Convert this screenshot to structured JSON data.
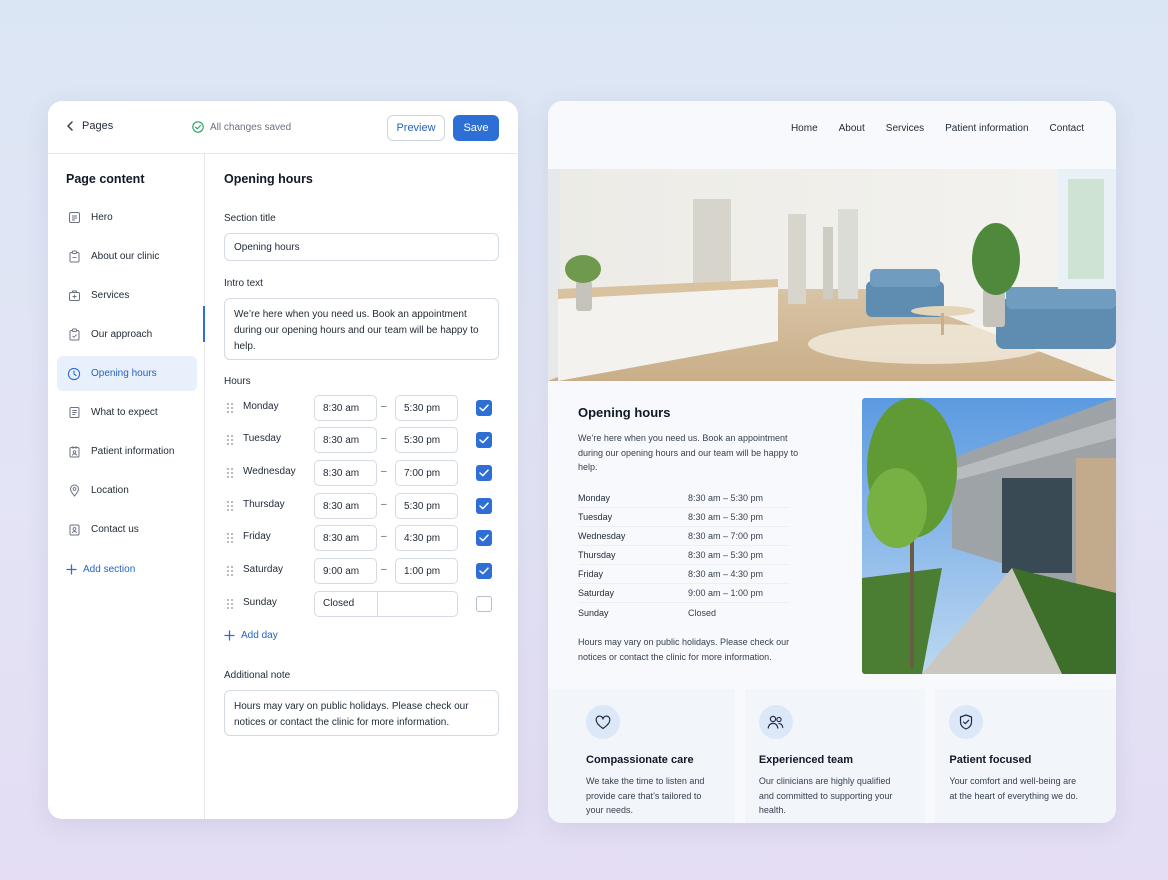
{
  "editor": {
    "back_label": "Pages",
    "save_status": "All changes saved",
    "preview_button": "Preview",
    "save_button": "Save",
    "sidebar": {
      "title": "Page content",
      "items": [
        {
          "label": "Hero",
          "icon": "text-block-icon"
        },
        {
          "label": "About our clinic",
          "icon": "clipboard-icon"
        },
        {
          "label": "Services",
          "icon": "medical-case-icon"
        },
        {
          "label": "Our approach",
          "icon": "clipboard-check-icon"
        },
        {
          "label": "Opening hours",
          "icon": "clock-icon",
          "active": true
        },
        {
          "label": "What to expect",
          "icon": "document-icon"
        },
        {
          "label": "Patient information",
          "icon": "id-badge-icon"
        },
        {
          "label": "Location",
          "icon": "map-pin-icon"
        },
        {
          "label": "Contact us",
          "icon": "contact-card-icon"
        }
      ],
      "add_section": "Add section"
    },
    "form": {
      "title": "Opening hours",
      "section_title_label": "Section title",
      "section_title_value": "Opening hours",
      "intro_label": "Intro text",
      "intro_value": "We’re here when you need us. Book an appointment during our opening hours and our team will be happy to help.",
      "hours_label": "Hours",
      "hours": [
        {
          "day": "Monday",
          "from": "8:30 am",
          "to": "5:30 pm",
          "open": true
        },
        {
          "day": "Tuesday",
          "from": "8:30 am",
          "to": "5:30 pm",
          "open": true
        },
        {
          "day": "Wednesday",
          "from": "8:30 am",
          "to": "7:00 pm",
          "open": true
        },
        {
          "day": "Thursday",
          "from": "8:30 am",
          "to": "5:30 pm",
          "open": true
        },
        {
          "day": "Friday",
          "from": "8:30 am",
          "to": "4:30 pm",
          "open": true
        },
        {
          "day": "Saturday",
          "from": "9:00 am",
          "to": "1:00 pm",
          "open": true
        },
        {
          "day": "Sunday",
          "closed_label": "Closed",
          "open": false
        }
      ],
      "separator": "–",
      "add_day": "Add day",
      "note_label": "Additional note",
      "note_value": "Hours may vary on public holidays. Please check our notices or contact the clinic for more information."
    }
  },
  "preview": {
    "nav": [
      "Home",
      "About",
      "Services",
      "Patient information",
      "Contact"
    ],
    "section_title": "Opening hours",
    "intro": "We’re here when you need us. Book an appointment during our opening hours and our team will be happy to help.",
    "hours": [
      {
        "day": "Monday",
        "hours": "8:30 am – 5:30 pm"
      },
      {
        "day": "Tuesday",
        "hours": "8:30 am – 5:30 pm"
      },
      {
        "day": "Wednesday",
        "hours": "8:30 am – 7:00 pm"
      },
      {
        "day": "Thursday",
        "hours": "8:30 am – 5:30 pm"
      },
      {
        "day": "Friday",
        "hours": "8:30 am – 4:30 pm"
      },
      {
        "day": "Saturday",
        "hours": "9:00 am – 1:00 pm"
      },
      {
        "day": "Sunday",
        "hours": "Closed"
      }
    ],
    "note": "Hours may vary on public holidays. Please check our notices or contact the clinic for more information.",
    "cards": [
      {
        "title": "Compassionate care",
        "text": "We take the time to listen and provide care that’s tailored to your needs.",
        "icon": "heart-icon"
      },
      {
        "title": "Experienced team",
        "text": "Our clinicians are highly qualified and committed to supporting your health.",
        "icon": "people-icon"
      },
      {
        "title": "Patient focused",
        "text": "Your comfort and well-being are at the heart of everything we do.",
        "icon": "shield-check-icon"
      }
    ]
  },
  "colors": {
    "accent": "#2d6fd4",
    "active_bg": "#e8f0fc",
    "success": "#22a35a"
  }
}
